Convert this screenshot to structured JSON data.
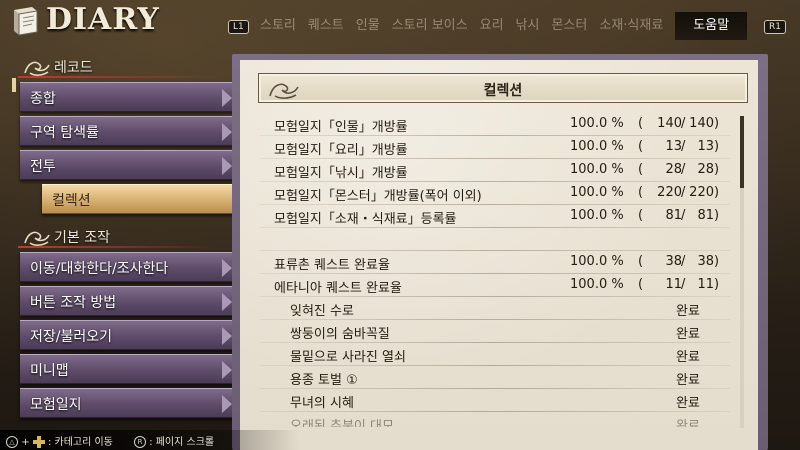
{
  "header": {
    "title": "DIARY",
    "left_button": "L1",
    "right_button": "R1",
    "tabs": [
      "스토리",
      "퀘스트",
      "인물",
      "스토리 보이스",
      "요리",
      "낚시",
      "몬스터",
      "소재·식재료",
      "도움말"
    ],
    "active_tab": "도움말"
  },
  "sidebar": {
    "record_title": "레코드",
    "record_items": [
      "종합",
      "구역 탐색률",
      "전투"
    ],
    "selected_item": "컬렉션",
    "basic_title": "기본 조작",
    "basic_items": [
      "이동/대화한다/조사한다",
      "버튼 조작 방법",
      "저장/불러오기",
      "미니맵",
      "모험일지"
    ]
  },
  "panel": {
    "title": "컬렉션",
    "rows": [
      {
        "label": "모험일지「인물」개방률",
        "pct": "100.0 %",
        "num": "140",
        "den": "140"
      },
      {
        "label": "모험일지「요리」개방률",
        "pct": "100.0 %",
        "num": "13",
        "den": "13"
      },
      {
        "label": "모험일지「낚시」개방률",
        "pct": "100.0 %",
        "num": "28",
        "den": "28"
      },
      {
        "label": "모험일지「몬스터」개방률(폭어 이외)",
        "pct": "100.0 %",
        "num": "220",
        "den": "220"
      },
      {
        "label": "모험일지「소재・식재료」등록률",
        "pct": "100.0 %",
        "num": "81",
        "den": "81"
      },
      {
        "label": "표류촌 퀘스트 완료율",
        "pct": "100.0 %",
        "num": "38",
        "den": "38"
      },
      {
        "label": "에타니아 퀘스트 완료율",
        "pct": "100.0 %",
        "num": "11",
        "den": "11"
      }
    ],
    "quests": [
      {
        "label": "잊혀진 수로",
        "status": "완료"
      },
      {
        "label": "쌍둥이의 숨바꼭질",
        "status": "완료"
      },
      {
        "label": "물밑으로 사라진 열쇠",
        "status": "완료"
      },
      {
        "label": "용종 토벌 ①",
        "status": "완료"
      },
      {
        "label": "무녀의 시혜",
        "status": "완료"
      },
      {
        "label": "오래된 추분이 대모",
        "status": "완료"
      }
    ]
  },
  "footer": {
    "category_text": ": 카테고리 이동",
    "page_text": ": 페이지 스크롤",
    "plus": "+"
  },
  "scroll": {
    "position_fraction": 0.0,
    "visible_fraction": 0.23
  }
}
